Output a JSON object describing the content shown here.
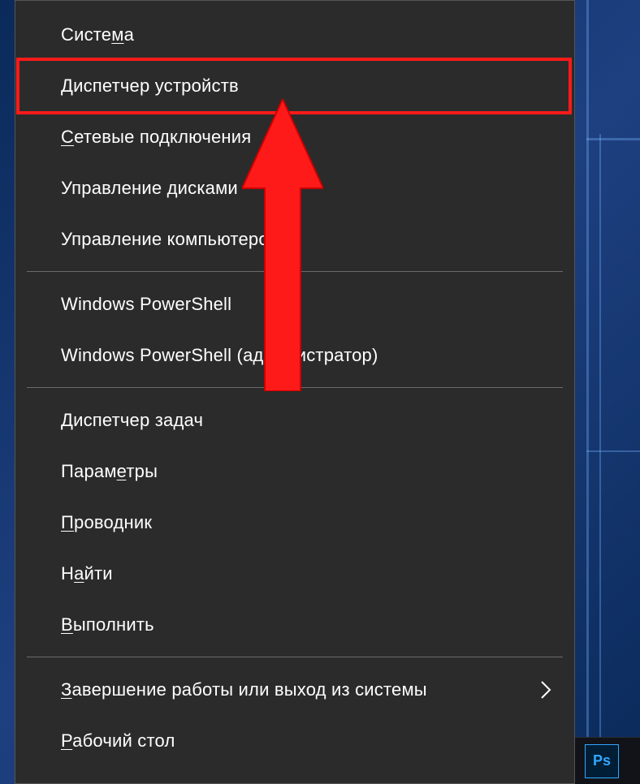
{
  "menu": {
    "groups": [
      {
        "items": [
          {
            "label": "Система",
            "accelPos": 5,
            "hasSubmenu": false,
            "name": "menu-item-system"
          },
          {
            "label": "Диспетчер устройств",
            "accelPos": null,
            "hasSubmenu": false,
            "name": "menu-item-device-manager",
            "highlighted": true
          },
          {
            "label": "Сетевые подключения",
            "accelPos": 0,
            "hasSubmenu": false,
            "name": "menu-item-network-connections"
          },
          {
            "label": "Управление дисками",
            "accelPos": null,
            "hasSubmenu": false,
            "name": "menu-item-disk-management"
          },
          {
            "label": "Управление компьютером",
            "accelPos": null,
            "hasSubmenu": false,
            "name": "menu-item-computer-management"
          }
        ]
      },
      {
        "items": [
          {
            "label": "Windows PowerShell",
            "accelPos": null,
            "hasSubmenu": false,
            "name": "menu-item-powershell"
          },
          {
            "label": "Windows PowerShell (администратор)",
            "accelPrefix": "Windows PowerShell (а",
            "accelChar": "д",
            "accelSuffix": "министратор)",
            "hasSubmenu": false,
            "name": "menu-item-powershell-admin"
          }
        ]
      },
      {
        "items": [
          {
            "label": "Диспетчер задач",
            "accelPos": 0,
            "hasSubmenu": false,
            "name": "menu-item-task-manager"
          },
          {
            "label": "Параметры",
            "accelPos": 5,
            "hasSubmenu": false,
            "name": "menu-item-settings"
          },
          {
            "label": "Проводник",
            "accelPos": 0,
            "hasSubmenu": false,
            "name": "menu-item-explorer"
          },
          {
            "label": "Найти",
            "accelPos": 1,
            "hasSubmenu": false,
            "name": "menu-item-search"
          },
          {
            "label": "Выполнить",
            "accelPos": 0,
            "hasSubmenu": false,
            "name": "menu-item-run"
          }
        ]
      },
      {
        "items": [
          {
            "label": "Завершение работы или выход из системы",
            "accelPos": 0,
            "hasSubmenu": true,
            "name": "menu-item-shutdown"
          },
          {
            "label": "Рабочий стол",
            "accelPos": 0,
            "hasSubmenu": false,
            "name": "menu-item-desktop"
          }
        ]
      }
    ]
  },
  "annotation": {
    "highlightColor": "#ff1a1a",
    "arrowColor": "#ff1a1a"
  },
  "taskbar": {
    "psLabel": "Ps"
  }
}
